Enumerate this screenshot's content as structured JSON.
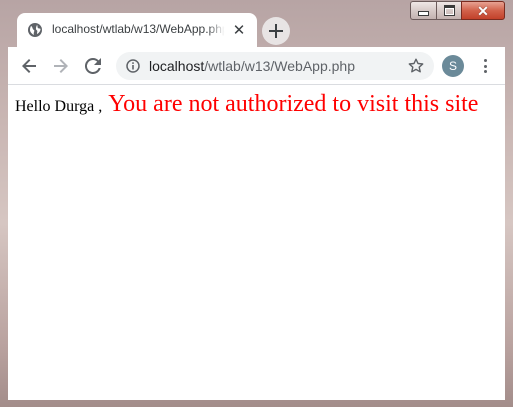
{
  "window": {
    "minimize_glyph": "minimize-icon",
    "maximize_glyph": "maximize-icon",
    "close_glyph": "✕"
  },
  "tab": {
    "title": "localhost/wtlab/w13/WebApp.php",
    "close_label": "✕",
    "icon": "globe-icon"
  },
  "toolbar": {
    "url_host": "localhost",
    "url_path": "/wtlab/w13/WebApp.php",
    "profile_initial": "S",
    "icons": [
      "back-arrow-icon",
      "forward-arrow-icon",
      "reload-icon",
      "info-icon",
      "star-icon",
      "more-menu-icon"
    ]
  },
  "page": {
    "greeting": "Hello Durga ,",
    "message": "You are not authorized to visit this site"
  },
  "colors": {
    "message": "#ff0000",
    "avatar": "#6b8a99"
  }
}
